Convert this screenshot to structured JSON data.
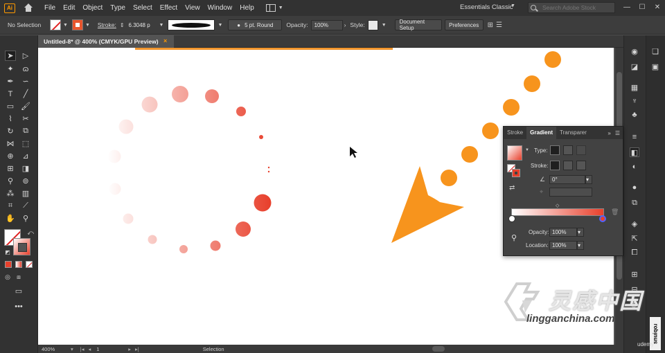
{
  "menubar": {
    "logo": "Ai",
    "items": [
      "File",
      "Edit",
      "Object",
      "Type",
      "Select",
      "Effect",
      "View",
      "Window",
      "Help"
    ],
    "workspace": "Essentials Classic",
    "search_placeholder": "Search Adobe Stock"
  },
  "controlbar": {
    "selection": "No Selection",
    "stroke_label": "Stroke:",
    "stroke_value": "6.3048 p",
    "brush_label": "5 pt. Round",
    "opacity_label": "Opacity:",
    "opacity_value": "100%",
    "style_label": "Style:",
    "document_setup": "Document Setup",
    "preferences": "Preferences"
  },
  "document": {
    "tab_title": "Untitled-8* @ 400% (CMYK/GPU Preview)",
    "close": "×"
  },
  "statusbar": {
    "zoom": "400%",
    "artboard": "1",
    "mode": "Selection"
  },
  "gradient_panel": {
    "tabs": [
      "Stroke",
      "Gradient",
      "Transparer"
    ],
    "type_label": "Type:",
    "stroke_label": "Stroke:",
    "angle_value": "0°",
    "opacity_label": "Opacity:",
    "opacity_value": "100%",
    "location_label": "Location:",
    "location_value": "100%",
    "stop_colors": [
      "#ffffff",
      "#e8402c"
    ]
  },
  "watermark": {
    "cn_text": "灵感中国",
    "url": "lingganchina.com",
    "udemy": "udemy",
    "side": "snuiqoɹ"
  },
  "colors": {
    "accent": "#ff9a00",
    "arrow": "#f7941d",
    "gradient_end": "#e8402c"
  }
}
